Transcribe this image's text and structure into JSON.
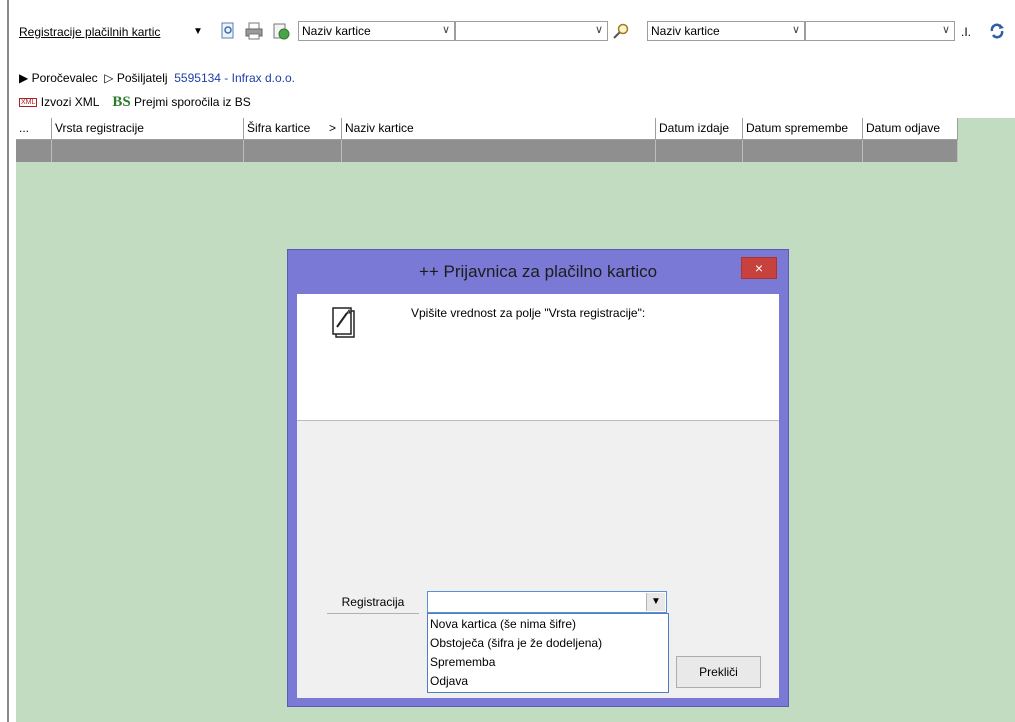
{
  "toolbar": {
    "title": "Registracije plačilnih kartic",
    "combo1_value": "Naziv kartice",
    "combo2_value": "",
    "combo3_value": "Naziv kartice",
    "combo4_value": "",
    "right_text": ".I.",
    "icons": [
      "preview-icon",
      "print-icon",
      "export-icon",
      "search-icon",
      "refresh-icon"
    ]
  },
  "nav": {
    "item1": "Poročevalec",
    "item2": "Pošiljatelj",
    "company": "5595134 - Infrax d.o.o."
  },
  "actions": {
    "export_label": "Izvozi XML",
    "xml_badge": "XML",
    "bs_badge": "BS",
    "receive_label": "Prejmi sporočila iz BS"
  },
  "grid": {
    "columns": [
      "...",
      "Vrsta registracije",
      "Šifra kartice",
      ">",
      "Naziv kartice",
      "Datum izdaje",
      "Datum spremembe",
      "Datum odjave"
    ]
  },
  "dialog": {
    "title": "++ Prijavnica za plačilno kartico",
    "close": "×",
    "prompt": "Vpišite vrednost za polje \"Vrsta registracije\":",
    "field_label": "Registracija",
    "field_value": "",
    "options": [
      "Nova kartica (še nima šifre)",
      "Obstoječa (šifra je že dodeljena)",
      "Sprememba",
      "Odjava"
    ],
    "cancel": "Prekliči"
  },
  "colors": {
    "grid_bg": "#c1dcc0",
    "dialog_frame": "#7a7ad6",
    "close_btn": "#c8423d",
    "link": "#1f3fa8"
  }
}
